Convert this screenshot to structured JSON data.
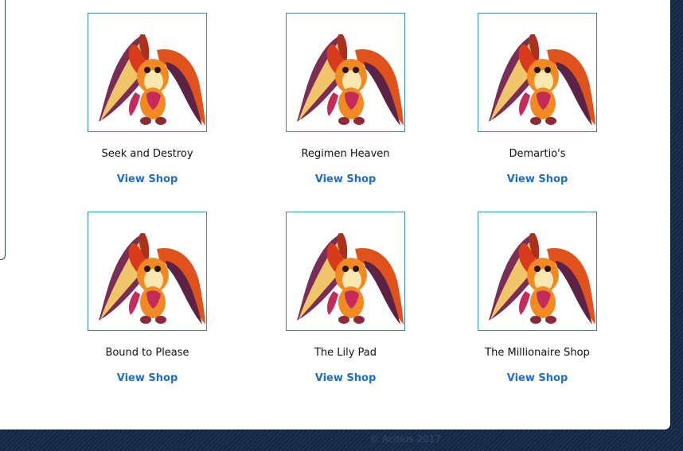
{
  "shops": [
    {
      "name": "Seek and Destroy",
      "link_label": "View Shop",
      "image": "pet-thumbnail"
    },
    {
      "name": "Regimen Heaven",
      "link_label": "View Shop",
      "image": "pet-thumbnail"
    },
    {
      "name": "Demartio's",
      "link_label": "View Shop",
      "image": "pet-thumbnail"
    },
    {
      "name": "Bound to Please",
      "link_label": "View Shop",
      "image": "pet-thumbnail"
    },
    {
      "name": "The Lily Pad",
      "link_label": "View Shop",
      "image": "pet-thumbnail"
    },
    {
      "name": "The Millionaire Shop",
      "link_label": "View Shop",
      "image": "pet-thumbnail"
    }
  ],
  "footer": {
    "text": "© Acitius 2017"
  },
  "colors": {
    "link": "#1f6ec8",
    "thumb_border": "#3d8ab3",
    "background": "#1e3253",
    "panel": "#ffffff"
  }
}
